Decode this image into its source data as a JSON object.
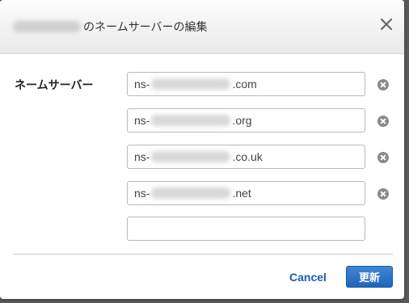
{
  "dialog": {
    "title_suffix": "のネームサーバーの編集",
    "close_icon": "close-icon"
  },
  "form": {
    "label": "ネームサーバー",
    "nameservers": [
      {
        "prefix": "ns-",
        "suffix": ".com"
      },
      {
        "prefix": "ns-",
        "suffix": ".org"
      },
      {
        "prefix": "ns-",
        "suffix": ".co.uk"
      },
      {
        "prefix": "ns-",
        "suffix": ".net"
      }
    ],
    "empty_input_value": ""
  },
  "footer": {
    "cancel_label": "Cancel",
    "update_label": "更新"
  },
  "colors": {
    "accent": "#1f66ba",
    "link": "#1e5bb0"
  }
}
